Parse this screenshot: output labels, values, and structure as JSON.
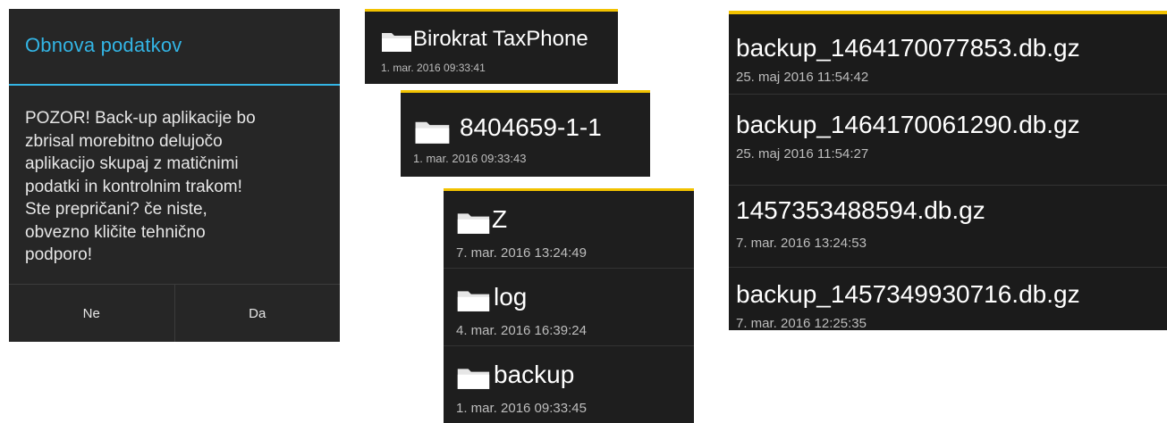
{
  "dialog": {
    "title": "Obnova podatkov",
    "message": "POZOR! Back-up aplikacije bo\nzbrisal morebitno delujočo\naplikacijo skupaj z matičnimi\npodatki in kontrolnim trakom!\nSte prepričani? če niste,\nobvezno kličite tehnično\npodporo!",
    "buttons": {
      "no": "Ne",
      "yes": "Da"
    },
    "accent": "#33b5e5"
  },
  "panel1": {
    "items": [
      {
        "name": "Birokrat TaxPhone",
        "date": "1. mar. 2016 09:33:41",
        "icon": "folder-icon"
      }
    ]
  },
  "panel2": {
    "items": [
      {
        "name": "8404659-1-1",
        "date": "1. mar. 2016 09:33:43",
        "icon": "folder-icon"
      }
    ]
  },
  "panel3": {
    "items": [
      {
        "name": "Z",
        "date": "7. mar. 2016 13:24:49",
        "icon": "folder-icon"
      },
      {
        "name": "log",
        "date": "4. mar. 2016 16:39:24",
        "icon": "folder-icon"
      },
      {
        "name": "backup",
        "date": "1. mar. 2016 09:33:45",
        "icon": "folder-icon"
      }
    ]
  },
  "panel4": {
    "items": [
      {
        "name": "backup_1464170077853.db.gz",
        "date": "25. maj 2016 11:54:42"
      },
      {
        "name": "backup_1464170061290.db.gz",
        "date": "25. maj 2016 11:54:27"
      },
      {
        "name": "1457353488594.db.gz",
        "date": "7. mar. 2016 13:24:53"
      },
      {
        "name": "backup_1457349930716.db.gz",
        "date": "7. mar. 2016 12:25:35"
      }
    ]
  },
  "colors": {
    "highlight": "#f2c200",
    "background": "#1e1e1e"
  }
}
